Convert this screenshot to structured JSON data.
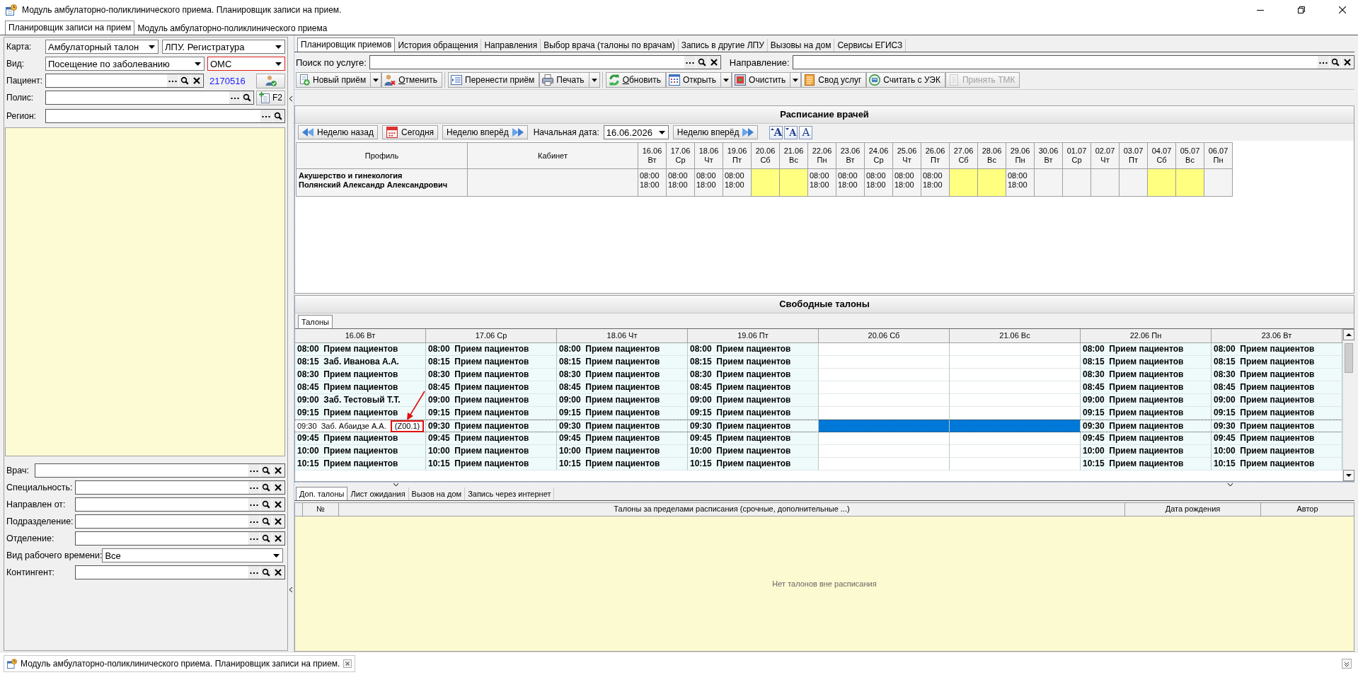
{
  "window": {
    "title": "Модуль амбулаторно-поликлинического приема. Планировщик записи на прием."
  },
  "module_tabs": [
    {
      "label": "Планировщик записи на прием",
      "selected": true
    },
    {
      "label": "Модуль амбулаторно-поликлинического приема",
      "selected": false
    }
  ],
  "card": {
    "label": "Карта:",
    "selects": [
      {
        "value": "Амбулаторный талон",
        "error": false
      },
      {
        "value": "ЛПУ. Регистратура",
        "error": false
      }
    ]
  },
  "visit": {
    "label": "Вид:",
    "selects": [
      {
        "value": "Посещение по заболеванию",
        "error": false
      },
      {
        "value": "ОМС",
        "error": true
      }
    ]
  },
  "patient": {
    "label": "Пациент:",
    "clear": true,
    "number": "2170516"
  },
  "policy": {
    "label": "Полис:",
    "clear": false,
    "button": "F2"
  },
  "region": {
    "label": "Регион:",
    "clear": false
  },
  "filters": [
    {
      "kind": "lookup",
      "label": "Врач:",
      "clear": true
    },
    {
      "kind": "lookup",
      "label": "Специальность:",
      "clear": true
    },
    {
      "kind": "lookup",
      "label": "Направлен от:",
      "clear": true
    },
    {
      "kind": "lookup",
      "label": "Подразделение:",
      "clear": true
    },
    {
      "kind": "lookup",
      "label": "Отделение:",
      "clear": true
    },
    {
      "kind": "select",
      "label": "Вид рабочего времени:",
      "value": "Все"
    },
    {
      "kind": "lookup",
      "label": "Контингент:",
      "clear": true
    }
  ],
  "main_tabs": [
    {
      "label": "Планировщик приемов",
      "selected": true
    },
    {
      "label": "История обращения",
      "selected": false
    },
    {
      "label": "Направления",
      "selected": false
    },
    {
      "label": "Выбор врача (талоны по врачам)",
      "selected": false
    },
    {
      "label": "Запись в другие ЛПУ",
      "selected": false
    },
    {
      "label": "Вызовы на дом",
      "selected": false
    },
    {
      "label": "Сервисы ЕГИСЗ",
      "selected": false
    }
  ],
  "service_search": {
    "label": "Поиск по услуге:",
    "clear": true
  },
  "referral": {
    "label": "Направление:",
    "clear": true
  },
  "toolbar": [
    [
      {
        "label": "Новый приём",
        "dropdown": true,
        "accel": false,
        "disabled": false
      },
      {
        "label": "Отменить",
        "dropdown": false,
        "accel": true,
        "disabled": false
      }
    ],
    [
      {
        "label": "Перенести приём",
        "dropdown": false,
        "accel": false,
        "disabled": false
      },
      {
        "label": "Печать",
        "dropdown": true,
        "accel": false,
        "disabled": false
      }
    ],
    [
      {
        "label": "Обновить",
        "dropdown": false,
        "accel": true,
        "disabled": false
      },
      {
        "label": "Открыть",
        "dropdown": true,
        "accel": false,
        "disabled": false
      },
      {
        "label": "Очистить",
        "dropdown": true,
        "accel": false,
        "disabled": false
      },
      {
        "label": "Свод услуг",
        "dropdown": false,
        "accel": false,
        "disabled": false
      },
      {
        "label": "Считать с УЭК",
        "dropdown": false,
        "accel": false,
        "disabled": false
      },
      {
        "label": "Принять ТМК",
        "dropdown": false,
        "accel": false,
        "disabled": true
      }
    ]
  ],
  "schedule": {
    "title": "Расписание врачей",
    "nav": {
      "back": "Неделю назад",
      "today": "Сегодня",
      "forward": "Неделю вперёд",
      "date_label": "Начальная дата:",
      "date": "16.06.2026",
      "forward_2": "Неделю вперёд",
      "font_buttons": [
        {
          "kind": "increase",
          "label": "A"
        },
        {
          "kind": "decrease",
          "label": "A"
        },
        {
          "kind": "reset",
          "label": "A"
        }
      ]
    },
    "profile_header": "Профиль",
    "room_header": "Кабинет",
    "days": [
      {
        "date": "16.06",
        "weekday": "Вт"
      },
      {
        "date": "17.06",
        "weekday": "Ср"
      },
      {
        "date": "18.06",
        "weekday": "Чт"
      },
      {
        "date": "19.06",
        "weekday": "Пт"
      },
      {
        "date": "20.06",
        "weekday": "Сб"
      },
      {
        "date": "21.06",
        "weekday": "Вс"
      },
      {
        "date": "22.06",
        "weekday": "Пн"
      },
      {
        "date": "23.06",
        "weekday": "Вт"
      },
      {
        "date": "24.06",
        "weekday": "Ср"
      },
      {
        "date": "25.06",
        "weekday": "Чт"
      },
      {
        "date": "26.06",
        "weekday": "Пт"
      },
      {
        "date": "27.06",
        "weekday": "Сб"
      },
      {
        "date": "28.06",
        "weekday": "Вс"
      },
      {
        "date": "29.06",
        "weekday": "Пн"
      },
      {
        "date": "30.06",
        "weekday": "Вт"
      },
      {
        "date": "01.07",
        "weekday": "Ср"
      },
      {
        "date": "02.07",
        "weekday": "Чт"
      },
      {
        "date": "03.07",
        "weekday": "Пт"
      },
      {
        "date": "04.07",
        "weekday": "Сб"
      },
      {
        "date": "05.07",
        "weekday": "Вс"
      },
      {
        "date": "06.07",
        "weekday": "Пн"
      }
    ],
    "rows": [
      {
        "profile": "Акушерство и гинекология",
        "doctor": "Полянский Александр Александрович",
        "cells": [
          {
            "kind": "hours",
            "start": "08:00",
            "end": "18:00"
          },
          {
            "kind": "hours",
            "start": "08:00",
            "end": "18:00"
          },
          {
            "kind": "hours",
            "start": "08:00",
            "end": "18:00"
          },
          {
            "kind": "hours",
            "start": "08:00",
            "end": "18:00"
          },
          {
            "kind": "day_off"
          },
          {
            "kind": "day_off"
          },
          {
            "kind": "hours",
            "start": "08:00",
            "end": "18:00"
          },
          {
            "kind": "hours",
            "start": "08:00",
            "end": "18:00"
          },
          {
            "kind": "hours",
            "start": "08:00",
            "end": "18:00"
          },
          {
            "kind": "hours",
            "start": "08:00",
            "end": "18:00"
          },
          {
            "kind": "hours",
            "start": "08:00",
            "end": "18:00"
          },
          {
            "kind": "day_off"
          },
          {
            "kind": "day_off"
          },
          {
            "kind": "hours",
            "start": "08:00",
            "end": "18:00"
          },
          {
            "kind": "none"
          },
          {
            "kind": "none"
          },
          {
            "kind": "none"
          },
          {
            "kind": "none"
          },
          {
            "kind": "day_off"
          },
          {
            "kind": "day_off"
          },
          {
            "kind": "none"
          }
        ]
      }
    ]
  },
  "free_slots": {
    "title": "Свободные талоны",
    "tabs": [
      {
        "label": "Талоны",
        "selected": true
      }
    ],
    "columns": [
      "16.06 Вт",
      "17.06 Ср",
      "18.06 Чт",
      "19.06 Пт",
      "20.06 Сб",
      "21.06 Вс",
      "22.06 Пн",
      "23.06 Вт"
    ],
    "rows": [
      {
        "selected": false,
        "cells": [
          {
            "time": "08:00",
            "text": "Прием пациентов",
            "focused": false
          },
          {
            "time": "08:00",
            "text": "Прием пациентов",
            "focused": false
          },
          {
            "time": "08:00",
            "text": "Прием пациентов",
            "focused": false
          },
          {
            "time": "08:00",
            "text": "Прием пациентов",
            "focused": false
          },
          null,
          null,
          {
            "time": "08:00",
            "text": "Прием пациентов",
            "focused": false
          },
          {
            "time": "08:00",
            "text": "Прием пациентов",
            "focused": false
          }
        ]
      },
      {
        "selected": false,
        "cells": [
          {
            "time": "08:15",
            "text": "Заб. Иванова А.А.",
            "focused": false
          },
          {
            "time": "08:15",
            "text": "Прием пациентов",
            "focused": false
          },
          {
            "time": "08:15",
            "text": "Прием пациентов",
            "focused": false
          },
          {
            "time": "08:15",
            "text": "Прием пациентов",
            "focused": false
          },
          null,
          null,
          {
            "time": "08:15",
            "text": "Прием пациентов",
            "focused": false
          },
          {
            "time": "08:15",
            "text": "Прием пациентов",
            "focused": false
          }
        ]
      },
      {
        "selected": false,
        "cells": [
          {
            "time": "08:30",
            "text": "Прием пациентов",
            "focused": false
          },
          {
            "time": "08:30",
            "text": "Прием пациентов",
            "focused": false
          },
          {
            "time": "08:30",
            "text": "Прием пациентов",
            "focused": false
          },
          {
            "time": "08:30",
            "text": "Прием пациентов",
            "focused": false
          },
          null,
          null,
          {
            "time": "08:30",
            "text": "Прием пациентов",
            "focused": false
          },
          {
            "time": "08:30",
            "text": "Прием пациентов",
            "focused": false
          }
        ]
      },
      {
        "selected": false,
        "cells": [
          {
            "time": "08:45",
            "text": "Прием пациентов",
            "focused": false
          },
          {
            "time": "08:45",
            "text": "Прием пациентов",
            "focused": false
          },
          {
            "time": "08:45",
            "text": "Прием пациентов",
            "focused": false
          },
          {
            "time": "08:45",
            "text": "Прием пациентов",
            "focused": false
          },
          null,
          null,
          {
            "time": "08:45",
            "text": "Прием пациентов",
            "focused": false
          },
          {
            "time": "08:45",
            "text": "Прием пациентов",
            "focused": false
          }
        ]
      },
      {
        "selected": false,
        "cells": [
          {
            "time": "09:00",
            "text": "Заб. Тестовый Т.Т.",
            "focused": false
          },
          {
            "time": "09:00",
            "text": "Прием пациентов",
            "focused": false
          },
          {
            "time": "09:00",
            "text": "Прием пациентов",
            "focused": false
          },
          {
            "time": "09:00",
            "text": "Прием пациентов",
            "focused": false
          },
          null,
          null,
          {
            "time": "09:00",
            "text": "Прием пациентов",
            "focused": false
          },
          {
            "time": "09:00",
            "text": "Прием пациентов",
            "focused": false
          }
        ]
      },
      {
        "selected": false,
        "cells": [
          {
            "time": "09:15",
            "text": "Прием пациентов",
            "focused": false
          },
          {
            "time": "09:15",
            "text": "Прием пациентов",
            "focused": false
          },
          {
            "time": "09:15",
            "text": "Прием пациентов",
            "focused": false
          },
          {
            "time": "09:15",
            "text": "Прием пациентов",
            "focused": false
          },
          null,
          null,
          {
            "time": "09:15",
            "text": "Прием пациентов",
            "focused": false
          },
          {
            "time": "09:15",
            "text": "Прием пациентов",
            "focused": false
          }
        ]
      },
      {
        "selected": true,
        "cells": [
          {
            "time": "09:30",
            "text": "Заб. Абаидзе А.А.",
            "code": "(Z00.1)",
            "focused": true
          },
          {
            "time": "09:30",
            "text": "Прием пациентов",
            "focused": false
          },
          {
            "time": "09:30",
            "text": "Прием пациентов",
            "focused": false
          },
          {
            "time": "09:30",
            "text": "Прием пациентов",
            "focused": false
          },
          null,
          null,
          {
            "time": "09:30",
            "text": "Прием пациентов",
            "focused": false
          },
          {
            "time": "09:30",
            "text": "Прием пациентов",
            "focused": false
          }
        ]
      },
      {
        "selected": false,
        "cells": [
          {
            "time": "09:45",
            "text": "Прием пациентов",
            "focused": false
          },
          {
            "time": "09:45",
            "text": "Прием пациентов",
            "focused": false
          },
          {
            "time": "09:45",
            "text": "Прием пациентов",
            "focused": false
          },
          {
            "time": "09:45",
            "text": "Прием пациентов",
            "focused": false
          },
          null,
          null,
          {
            "time": "09:45",
            "text": "Прием пациентов",
            "focused": false
          },
          {
            "time": "09:45",
            "text": "Прием пациентов",
            "focused": false
          }
        ]
      },
      {
        "selected": false,
        "cells": [
          {
            "time": "10:00",
            "text": "Прием пациентов",
            "focused": false
          },
          {
            "time": "10:00",
            "text": "Прием пациентов",
            "focused": false
          },
          {
            "time": "10:00",
            "text": "Прием пациентов",
            "focused": false
          },
          {
            "time": "10:00",
            "text": "Прием пациентов",
            "focused": false
          },
          null,
          null,
          {
            "time": "10:00",
            "text": "Прием пациентов",
            "focused": false
          },
          {
            "time": "10:00",
            "text": "Прием пациентов",
            "focused": false
          }
        ]
      },
      {
        "selected": false,
        "cells": [
          {
            "time": "10:15",
            "text": "Прием пациентов",
            "focused": false
          },
          {
            "time": "10:15",
            "text": "Прием пациентов",
            "focused": false
          },
          {
            "time": "10:15",
            "text": "Прием пациентов",
            "focused": false
          },
          {
            "time": "10:15",
            "text": "Прием пациентов",
            "focused": false
          },
          null,
          null,
          {
            "time": "10:15",
            "text": "Прием пациентов",
            "focused": false
          },
          {
            "time": "10:15",
            "text": "Прием пациентов",
            "focused": false
          }
        ]
      }
    ]
  },
  "extra_tabs": [
    {
      "label": "Доп. талоны",
      "selected": true
    },
    {
      "label": "Лист ожидания",
      "selected": false
    },
    {
      "label": "Вызов на дом",
      "selected": false
    },
    {
      "label": "Запись через интернет",
      "selected": false
    }
  ],
  "extra_table": {
    "columns": [
      "№",
      "Талоны за пределами расписания (срочные, дополнительные ...)",
      "Дата рождения",
      "Автор"
    ],
    "empty_text": "Нет талонов вне расписания"
  },
  "taskbar": [
    {
      "label": "Модуль амбулаторно-поликлинического приема. Планировщик записи на прием."
    }
  ]
}
